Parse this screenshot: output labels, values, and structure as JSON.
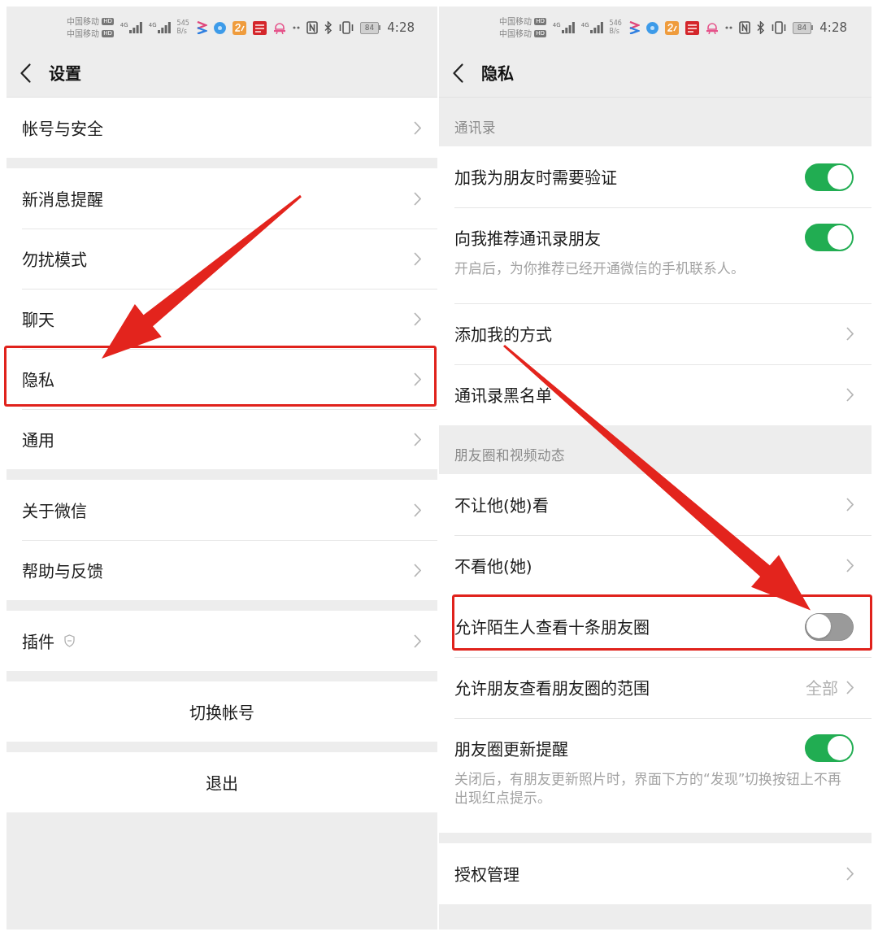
{
  "screens": [
    {
      "status_bar": {
        "carriers": [
          {
            "name": "中国移动",
            "badge": "HD"
          },
          {
            "name": "中国移动",
            "badge": "HD"
          }
        ],
        "signals": [
          {
            "network": "4G"
          },
          {
            "network": "4G"
          }
        ],
        "speed": "545",
        "speed_unit": "B/s",
        "battery": "84",
        "time": "4:28"
      },
      "header": {
        "title": "设置"
      },
      "groups": [
        {
          "rows": [
            {
              "kind": "link",
              "label": "帐号与安全",
              "highlighted": false
            }
          ]
        },
        {
          "rows": [
            {
              "kind": "link",
              "label": "新消息提醒",
              "highlighted": false
            },
            {
              "kind": "link",
              "label": "勿扰模式",
              "highlighted": false
            },
            {
              "kind": "link",
              "label": "聊天",
              "highlighted": false
            },
            {
              "kind": "link",
              "label": "隐私",
              "highlighted": true
            },
            {
              "kind": "link",
              "label": "通用",
              "highlighted": false
            }
          ]
        },
        {
          "rows": [
            {
              "kind": "link",
              "label": "关于微信",
              "highlighted": false
            },
            {
              "kind": "link",
              "label": "帮助与反馈",
              "highlighted": false
            }
          ]
        },
        {
          "rows": [
            {
              "kind": "link_icon",
              "label": "插件",
              "highlighted": false
            }
          ]
        },
        {
          "rows": [
            {
              "kind": "button",
              "label": "切换帐号",
              "highlighted": false
            }
          ]
        },
        {
          "rows": [
            {
              "kind": "button",
              "label": "退出",
              "highlighted": false
            }
          ]
        }
      ]
    },
    {
      "status_bar": {
        "carriers": [
          {
            "name": "中国移动",
            "badge": "HD"
          },
          {
            "name": "中国移动",
            "badge": "HD"
          }
        ],
        "signals": [
          {
            "network": "4G"
          },
          {
            "network": "4G"
          }
        ],
        "speed": "546",
        "speed_unit": "B/s",
        "battery": "84",
        "time": "4:28"
      },
      "header": {
        "title": "隐私"
      },
      "groups": [
        {
          "title": "通讯录",
          "rows": [
            {
              "kind": "toggle",
              "label": "加我为朋友时需要验证",
              "on": true,
              "highlighted": false
            },
            {
              "kind": "toggle",
              "label": "向我推荐通讯录朋友",
              "on": true,
              "description": "开启后，为你推荐已经开通微信的手机联系人。",
              "highlighted": false
            },
            {
              "kind": "link",
              "label": "添加我的方式",
              "highlighted": false
            },
            {
              "kind": "link",
              "label": "通讯录黑名单",
              "highlighted": false
            }
          ]
        },
        {
          "title": "朋友圈和视频动态",
          "rows": [
            {
              "kind": "link",
              "label": "不让他(她)看",
              "highlighted": false
            },
            {
              "kind": "link",
              "label": "不看他(她)",
              "highlighted": false
            },
            {
              "kind": "toggle",
              "label": "允许陌生人查看十条朋友圈",
              "on": false,
              "highlighted": true
            },
            {
              "kind": "link",
              "label": "允许朋友查看朋友圈的范围",
              "value": "全部",
              "highlighted": false
            },
            {
              "kind": "toggle",
              "label": "朋友圈更新提醒",
              "on": true,
              "description": "关闭后，有朋友更新照片时，界面下方的“发现”切换按钮上不再出现红点提示。",
              "highlighted": false
            }
          ]
        },
        {
          "rows": [
            {
              "kind": "link",
              "label": "授权管理",
              "highlighted": false
            }
          ]
        }
      ]
    }
  ]
}
